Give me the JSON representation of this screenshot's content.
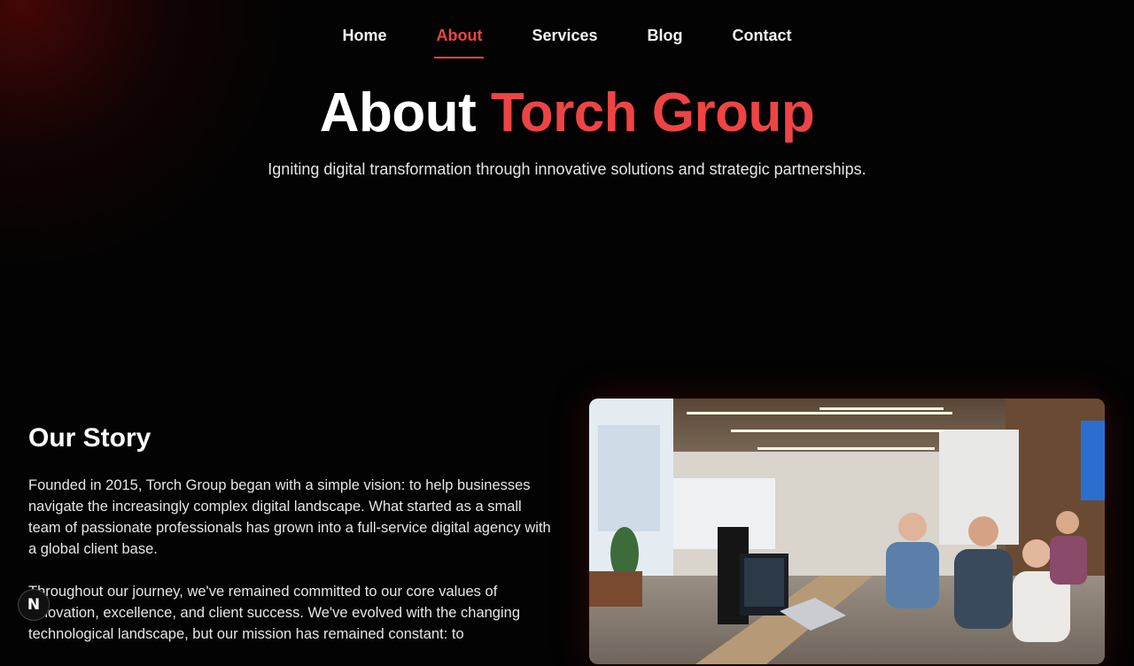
{
  "nav": {
    "items": [
      {
        "label": "Home"
      },
      {
        "label": "About",
        "active": true
      },
      {
        "label": "Services"
      },
      {
        "label": "Blog"
      },
      {
        "label": "Contact"
      }
    ]
  },
  "hero": {
    "title_plain": "About",
    "title_accent": "Torch Group",
    "subtitle": "Igniting digital transformation through innovative solutions and strategic partnerships."
  },
  "story": {
    "heading": "Our Story",
    "paragraph1": "Founded in 2015, Torch Group began with a simple vision: to help businesses navigate the increasingly complex digital landscape. What started as a small team of passionate professionals has grown into a full-service digital agency with a global client base.",
    "paragraph2": "Throughout our journey, we've remained committed to our core values of innovation, excellence, and client success. We've evolved with the changing technological landscape, but our mission has remained constant: to"
  },
  "badge": {
    "label": "N"
  },
  "colors": {
    "accent": "#ef4444",
    "background": "#030303"
  }
}
